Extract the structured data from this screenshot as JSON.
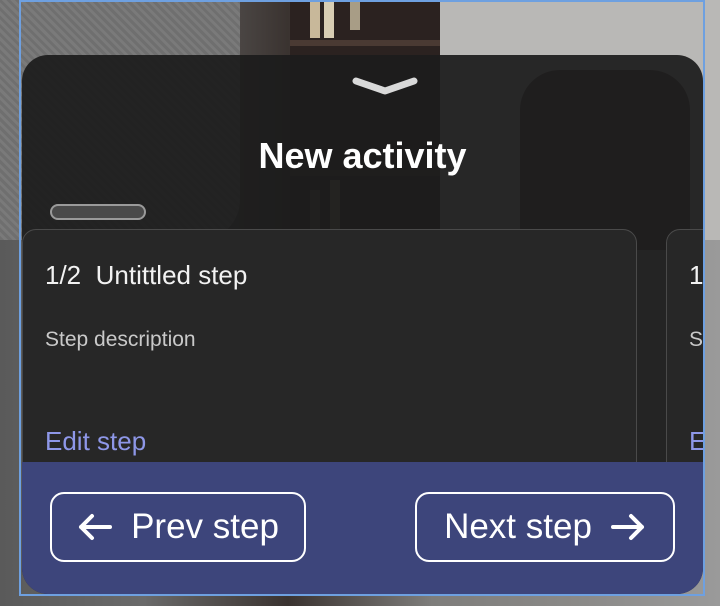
{
  "sheet": {
    "title": "New activity"
  },
  "step_card": {
    "index_label": "1/2",
    "title": "Untittled step",
    "description": "Step description",
    "edit_label": "Edit step"
  },
  "next_card_peek": {
    "index_label": "1",
    "description_initial": "S",
    "edit_initial": "E"
  },
  "footer": {
    "prev_label": "Prev step",
    "next_label": "Next step"
  },
  "icons": {
    "collapse": "chevron-down-icon",
    "prev": "arrow-left-icon",
    "next": "arrow-right-icon"
  },
  "colors": {
    "sheet_bg": "#1c1c1c",
    "card_bg": "#272727",
    "footer_bg": "#3d457b",
    "link": "#8e97e8",
    "text": "#ffffff"
  }
}
